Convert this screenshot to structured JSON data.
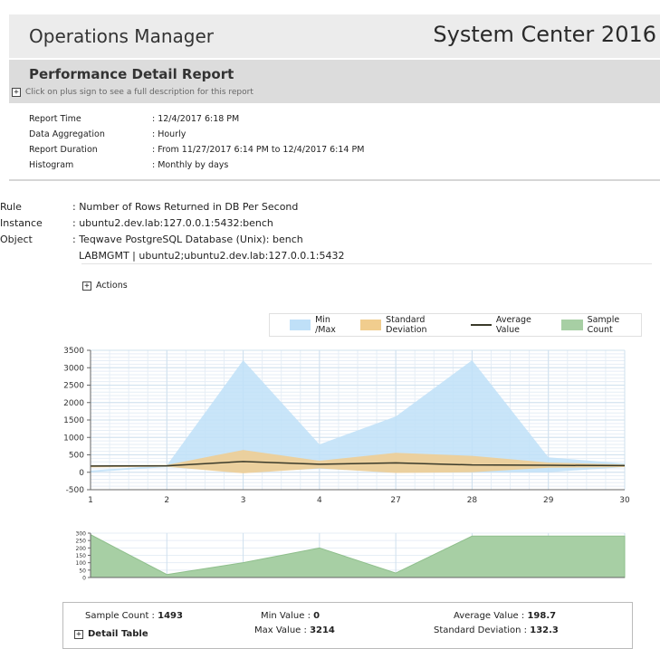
{
  "header": {
    "app_title": "Operations Manager",
    "product": "System Center 2016"
  },
  "report": {
    "title": "Performance Detail Report",
    "description_hint": "Click on plus sign to see a full description for this report",
    "plus": "+"
  },
  "meta": [
    {
      "key": "Report Time",
      "value": ": 12/4/2017 6:18 PM"
    },
    {
      "key": "Data Aggregation",
      "value": ": Hourly"
    },
    {
      "key": "Report Duration",
      "value": ": From  11/27/2017 6:14 PM  to  12/4/2017 6:14 PM"
    },
    {
      "key": "Histogram",
      "value": ": Monthly by days"
    }
  ],
  "rule": [
    {
      "key": "Rule",
      "value": ": Number of Rows Returned in DB Per Second"
    },
    {
      "key": "Instance",
      "value": ": ubuntu2.dev.lab:127.0.0.1:5432:bench"
    },
    {
      "key": "Object",
      "value": ": Teqwave PostgreSQL Database (Unix): bench"
    },
    {
      "key": "",
      "value": "  LABMGMT | ubuntu2;ubuntu2.dev.lab:127.0.0.1:5432"
    }
  ],
  "actions_label": "Actions",
  "legend": {
    "minmax": "Min /Max",
    "stddev": "Standard Deviation",
    "average": "Average Value",
    "sample": "Sample Count"
  },
  "colors": {
    "minmax": "#bfe0f8",
    "stddev": "#f1cd8e",
    "average": "#3a3a2a",
    "sample": "#a7cfa4",
    "grid": "#cfe0ee"
  },
  "chart_data": [
    {
      "type": "area",
      "categories": [
        "1",
        "2",
        "3",
        "4",
        "27",
        "28",
        "29",
        "30"
      ],
      "ylim": [
        -500,
        3500
      ],
      "yticks": [
        -500,
        0,
        500,
        1000,
        1500,
        2000,
        2500,
        3000,
        3500
      ],
      "series": [
        {
          "name": "Min /Max",
          "min": [
            0,
            150,
            0,
            100,
            0,
            0,
            0,
            150
          ],
          "max": [
            50,
            200,
            3214,
            800,
            1600,
            3214,
            430,
            250
          ]
        },
        {
          "name": "Standard Deviation",
          "low": [
            140,
            160,
            -30,
            110,
            -20,
            0,
            130,
            150
          ],
          "high": [
            200,
            210,
            640,
            330,
            560,
            470,
            280,
            220
          ]
        },
        {
          "name": "Average Value",
          "values": [
            180,
            185,
            310,
            230,
            270,
            210,
            200,
            190
          ]
        }
      ]
    },
    {
      "type": "area",
      "categories": [
        "1",
        "2",
        "3",
        "4",
        "27",
        "28",
        "29",
        "30"
      ],
      "ylim": [
        0,
        300
      ],
      "yticks": [
        0,
        50,
        100,
        150,
        200,
        250,
        300
      ],
      "series": [
        {
          "name": "Sample Count",
          "values": [
            290,
            20,
            100,
            200,
            30,
            280,
            280,
            280
          ]
        }
      ]
    }
  ],
  "summary": {
    "sample_count_label": "Sample Count :",
    "sample_count": "1493",
    "min_label": "Min Value :",
    "min": "0",
    "max_label": "Max Value :",
    "max": "3214",
    "avg_label": "Average Value :",
    "avg": "198.7",
    "std_label": "Standard Deviation :",
    "std": "132.3",
    "detail_table": "Detail Table"
  }
}
